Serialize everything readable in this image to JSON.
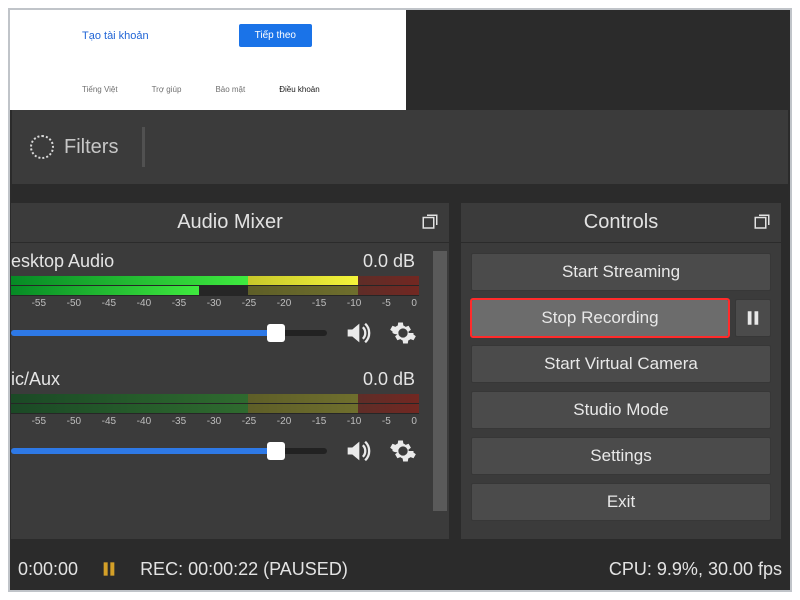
{
  "preview_card": {
    "link_text": "Tạo tài khoản",
    "button_text": "Tiếp theo",
    "footer_lang": "Tiếng Việt",
    "footer_items": [
      "Trợ giúp",
      "Bảo mật",
      "Điều khoản"
    ]
  },
  "filters": {
    "label": "Filters"
  },
  "panels": {
    "mixer": {
      "title": "Audio Mixer",
      "channels": [
        {
          "name": "esktop Audio",
          "db": "0.0 dB",
          "ticks": [
            "",
            "-55",
            "-50",
            "-45",
            "-40",
            "-35",
            "-30",
            "-25",
            "-20",
            "-15",
            "-10",
            "-5",
            "0"
          ]
        },
        {
          "name": "ic/Aux",
          "db": "0.0 dB",
          "ticks": [
            "",
            "-55",
            "-50",
            "-45",
            "-40",
            "-35",
            "-30",
            "-25",
            "-20",
            "-15",
            "-10",
            "-5",
            "0"
          ]
        }
      ]
    },
    "controls": {
      "title": "Controls",
      "buttons": {
        "start_streaming": "Start Streaming",
        "stop_recording": "Stop Recording",
        "start_virtual_camera": "Start Virtual Camera",
        "studio_mode": "Studio Mode",
        "settings": "Settings",
        "exit": "Exit"
      }
    }
  },
  "status": {
    "live_time": "0:00:00",
    "rec_text": "REC: 00:00:22 (PAUSED)",
    "cpu_text": "CPU: 9.9%, 30.00 fps"
  }
}
